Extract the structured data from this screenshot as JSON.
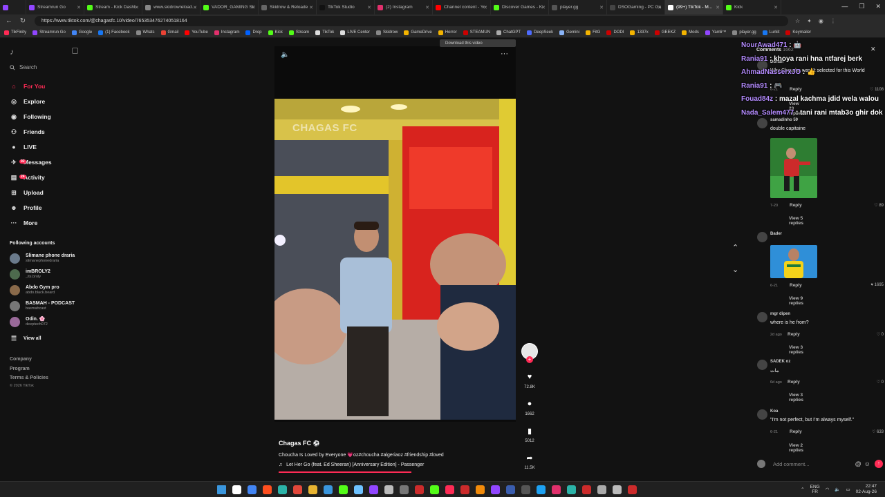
{
  "browser": {
    "tabs": [
      {
        "label": "",
        "color": "#9146ff"
      },
      {
        "label": "Streamrun Go",
        "color": "#9146ff"
      },
      {
        "label": "Stream - Kick Dashb",
        "color": "#53fc18"
      },
      {
        "label": "www.skidrowreload...",
        "color": "#888888"
      },
      {
        "label": "VADOR_GAMING Str",
        "color": "#53fc18"
      },
      {
        "label": "Skidrow & Reloade",
        "color": "#666666"
      },
      {
        "label": "TikTok Studio",
        "color": "#111111"
      },
      {
        "label": "(2) Instagram",
        "color": "#e1306c"
      },
      {
        "label": "Channel content - Yo",
        "color": "#ff0000"
      },
      {
        "label": "Discover Games - Ki",
        "color": "#53fc18"
      },
      {
        "label": "player.gg",
        "color": "#555555"
      },
      {
        "label": "DSOGaming - PC Ga",
        "color": "#444444"
      },
      {
        "label": "(99+) TikTok - M...",
        "color": "#ffffff",
        "active": true
      },
      {
        "label": "Kick",
        "color": "#53fc18"
      }
    ],
    "url": "https://www.tiktok.com/@chagasfc.10/video/7653534762740518164",
    "bookmarks": [
      {
        "label": "TikFinity",
        "color": "#ff2b55"
      },
      {
        "label": "Streamrun Go",
        "color": "#9146ff"
      },
      {
        "label": "Google",
        "color": "#4285f4"
      },
      {
        "label": "(1) Facebook",
        "color": "#1877f2"
      },
      {
        "label": "Whats",
        "color": "#888888"
      },
      {
        "label": "Gmail",
        "color": "#ea4335"
      },
      {
        "label": "YouTube",
        "color": "#ff0000"
      },
      {
        "label": "Instagram",
        "color": "#e1306c"
      },
      {
        "label": "Drop",
        "color": "#0061ff"
      },
      {
        "label": "Kick",
        "color": "#53fc18"
      },
      {
        "label": "Stream",
        "color": "#53fc18"
      },
      {
        "label": "TikTok",
        "color": "#dddddd"
      },
      {
        "label": "LIVE Center",
        "color": "#dddddd"
      },
      {
        "label": "Skidrow",
        "color": "#888888"
      },
      {
        "label": "GameDrive",
        "color": "#f4b400"
      },
      {
        "label": "Horror",
        "color": "#f4b400"
      },
      {
        "label": "STEAMUN",
        "color": "#cc0000"
      },
      {
        "label": "ChatGPT",
        "color": "#aaaaaa"
      },
      {
        "label": "DeepSeek",
        "color": "#4d6bfe"
      },
      {
        "label": "Gemini",
        "color": "#8ab4f8"
      },
      {
        "label": "FitG",
        "color": "#f4b400"
      },
      {
        "label": "DODI",
        "color": "#cc0000"
      },
      {
        "label": "1337x",
        "color": "#f4b400"
      },
      {
        "label": "GEEKZ",
        "color": "#cc0000"
      },
      {
        "label": "Mods",
        "color": "#f4b400"
      },
      {
        "label": "Yamli™",
        "color": "#9146ff"
      },
      {
        "label": "player.gg",
        "color": "#888888"
      },
      {
        "label": "Lurkit",
        "color": "#1877f2"
      },
      {
        "label": "Keymailer",
        "color": "#cc0000"
      }
    ]
  },
  "sidebar": {
    "search_placeholder": "Search",
    "nav": [
      {
        "label": "For You",
        "icon": "home-icon",
        "glyph": "⌂",
        "active": true,
        "badge": ""
      },
      {
        "label": "Explore",
        "icon": "compass-icon",
        "glyph": "◎",
        "badge": ""
      },
      {
        "label": "Following",
        "icon": "following-icon",
        "glyph": "◉",
        "badge": ""
      },
      {
        "label": "Friends",
        "icon": "friends-icon",
        "glyph": "⚇",
        "badge": ""
      },
      {
        "label": "LIVE",
        "icon": "live-icon",
        "glyph": "●",
        "badge": ""
      },
      {
        "label": "Messages",
        "icon": "messages-icon",
        "glyph": "✈",
        "badge": "92"
      },
      {
        "label": "Activity",
        "icon": "activity-icon",
        "glyph": "▤",
        "badge": "24"
      },
      {
        "label": "Upload",
        "icon": "upload-icon",
        "glyph": "⊞",
        "badge": ""
      },
      {
        "label": "Profile",
        "icon": "profile-icon",
        "glyph": "☻",
        "badge": ""
      },
      {
        "label": "More",
        "icon": "more-icon",
        "glyph": "···",
        "badge": ""
      }
    ],
    "following_header": "Following accounts",
    "accounts": [
      {
        "name": "Slimane phone draria",
        "handle": "slimanephonedraria"
      },
      {
        "name": "imBROLY2",
        "handle": "_its.broly"
      },
      {
        "name": "Abdo Gym pro",
        "handle": "abdo.black.beard"
      },
      {
        "name": "BASMAH - PODCAST",
        "handle": "basmahcast"
      },
      {
        "name": "Odin. 🌸",
        "handle": "deeptech072"
      }
    ],
    "view_all": "View all",
    "footer": [
      "Company",
      "Program",
      "Terms & Policies"
    ],
    "copyright": "© 2026 TikTok"
  },
  "video": {
    "download_label": "Download this video",
    "watermark": "CHAGAS FC",
    "author": "Chagas FC",
    "caption": "Choucha Is Loved by Everyone 💗oz#choucha #algeriaoz #friendship #loved",
    "music": "Let Her Go (feat. Ed Sheeran) [Anniversary Edition] - Passenger",
    "progress": 0.55,
    "likes": "72.8K",
    "comments": "1662",
    "saves": "5012",
    "shares": "11.5K"
  },
  "comments_panel": {
    "title": "Comments",
    "count": "1662",
    "items": [
      {
        "user": "Durian",
        "text": "Why Choucha wasn't selected for this World",
        "date": "6-21",
        "likes": "1108"
      },
      {
        "user": "samadinho 59",
        "text": "double capitaine",
        "date": "7-20",
        "likes": "89",
        "replies": "View 5 replies"
      },
      {
        "user": "Bader",
        "text": "",
        "date": "6-21",
        "likes": "1695",
        "replies": "View 9 replies"
      },
      {
        "user": "mgr dipen",
        "text": "where is he from?",
        "date": "2d ago",
        "likes": "0",
        "replies": "View 3 replies"
      },
      {
        "user": "SADEK oz",
        "text": "مات",
        "date": "6d ago",
        "likes": "0",
        "replies": "View 3 replies"
      },
      {
        "user": "Koa",
        "text": "\"I'm not perfect, but I'm always myself.\"",
        "date": "6-21",
        "likes": "633",
        "replies": "View 2 replies"
      }
    ],
    "reply_label": "Reply",
    "view_more": "View 23 replies",
    "add_placeholder": "Add comment..."
  },
  "chat_overlay": [
    {
      "name": "NourAwad471",
      "msg": "🤖"
    },
    {
      "name": "Rania91",
      "msg": "khoya rani hna ntfarej berk"
    },
    {
      "name": "AhmadNasserxJO",
      "msg": "👍"
    },
    {
      "name": "Rania91",
      "msg": "🎮"
    },
    {
      "name": "Fouad84z",
      "msg": "mazal kachma jdid wela walou"
    },
    {
      "name": "Nada_Salem477",
      "msg": "tani rani mtab3o ghir dok"
    }
  ],
  "taskbar": {
    "lang": "ENG",
    "region": "FR",
    "time": "22:47",
    "date": "02-Aug-26"
  }
}
